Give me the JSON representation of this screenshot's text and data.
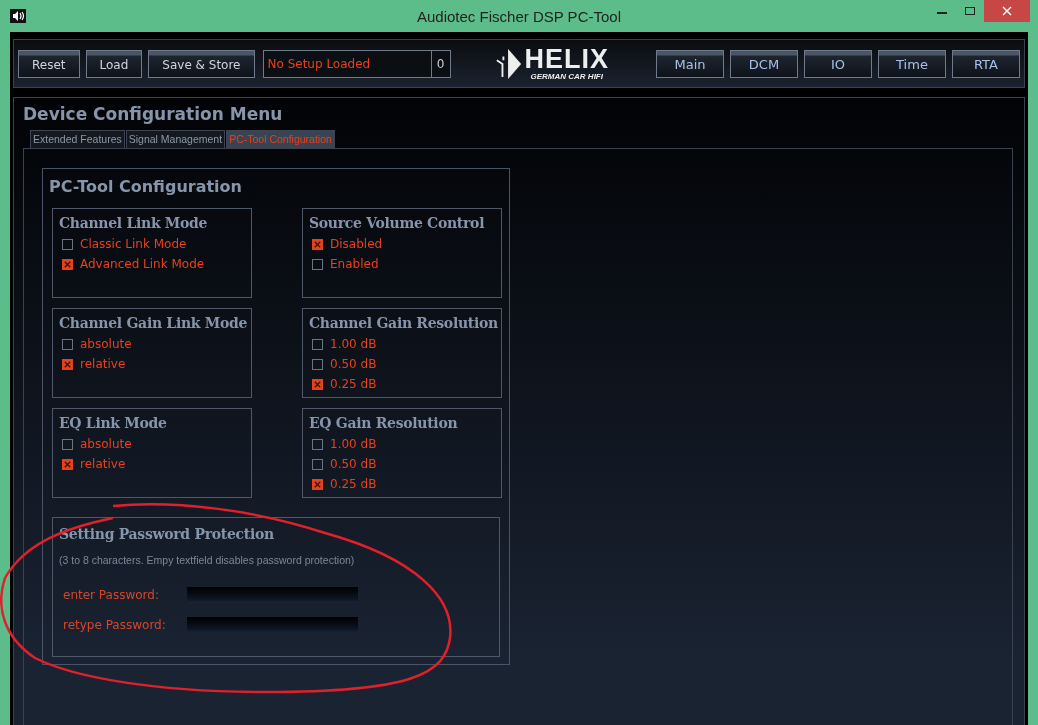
{
  "window": {
    "title": "Audiotec Fischer DSP PC-Tool"
  },
  "toolbar": {
    "buttons": [
      "Reset",
      "Load",
      "Save & Store"
    ],
    "setup_status": "No Setup Loaded",
    "setup_number": "0",
    "logo": {
      "brand": "HELIX",
      "tagline": "GERMAN CAR HIFI"
    },
    "nav_buttons": [
      "Main",
      "DCM",
      "IO",
      "Time",
      "RTA"
    ]
  },
  "menu": {
    "title": "Device Configuration Menu",
    "tabs": [
      {
        "label": "Extended Features",
        "selected": false
      },
      {
        "label": "Signal Management",
        "selected": false
      },
      {
        "label": "PC-Tool Configuration",
        "selected": true
      }
    ]
  },
  "config": {
    "title": "PC-Tool Configuration",
    "groups": [
      {
        "title": "Channel Link Mode",
        "options": [
          {
            "label": "Classic Link Mode",
            "checked": false
          },
          {
            "label": "Advanced Link Mode",
            "checked": true
          }
        ]
      },
      {
        "title": "Source Volume Control",
        "options": [
          {
            "label": "Disabled",
            "checked": true
          },
          {
            "label": "Enabled",
            "checked": false
          }
        ]
      },
      {
        "title": "Channel Gain Link Mode",
        "options": [
          {
            "label": "absolute",
            "checked": false
          },
          {
            "label": "relative",
            "checked": true
          }
        ]
      },
      {
        "title": "Channel Gain Resolution",
        "options": [
          {
            "label": "1.00 dB",
            "checked": false
          },
          {
            "label": "0.50 dB",
            "checked": false
          },
          {
            "label": "0.25 dB",
            "checked": true
          }
        ]
      },
      {
        "title": "EQ Link Mode",
        "options": [
          {
            "label": "absolute",
            "checked": false
          },
          {
            "label": "relative",
            "checked": true
          }
        ]
      },
      {
        "title": "EQ Gain Resolution",
        "options": [
          {
            "label": "1.00 dB",
            "checked": false
          },
          {
            "label": "0.50 dB",
            "checked": false
          },
          {
            "label": "0.25 dB",
            "checked": true
          }
        ]
      }
    ],
    "password": {
      "title": "Setting Password Protection",
      "hint": "(3 to 8 characters. Empy textfield disables password protection)",
      "fields": [
        {
          "label": "enter Password:"
        },
        {
          "label": "retype Password:"
        }
      ]
    }
  }
}
